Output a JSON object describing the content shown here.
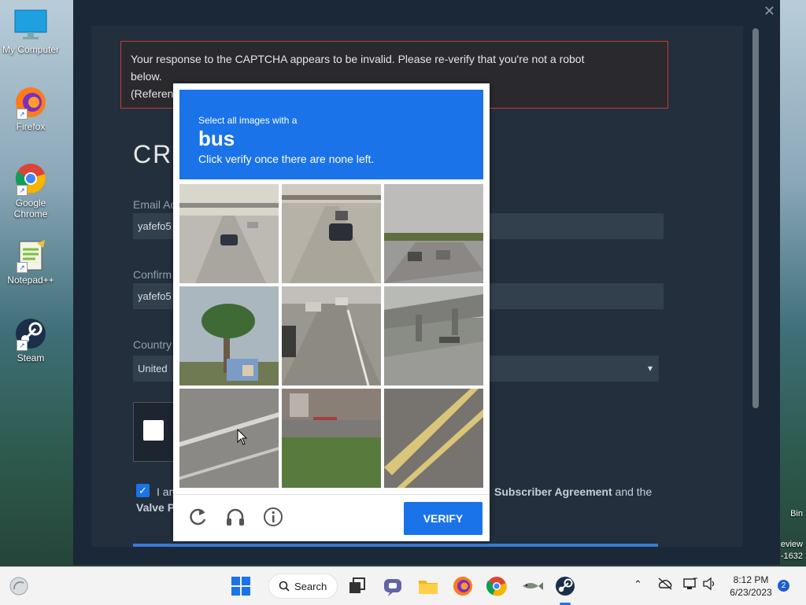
{
  "desktop": {
    "icons": [
      {
        "label": "My Computer"
      },
      {
        "label": "Firefox"
      },
      {
        "label": "Google Chrome"
      },
      {
        "label": "Notepad++"
      },
      {
        "label": "Steam"
      }
    ],
    "right_edge": {
      "bin": "Bin",
      "line1": "eview",
      "line2": "-1632"
    }
  },
  "window": {
    "close_glyph": "✕",
    "error": {
      "line1": "Your response to the CAPTCHA appears to be invalid. Please re-verify that you're not a robot",
      "line2": "below.",
      "line3": "(Referen"
    },
    "title": "CR",
    "email_label": "Email Ac",
    "email_value": "yafefo5",
    "confirm_label": "Confirm",
    "confirm_value": "yafefo5",
    "country_label": "Country",
    "country_value": "United",
    "agree_text": "I am",
    "agree_link1": "Subscriber Agreement",
    "agree_and": "and the",
    "agree_link2": "Valve Pr"
  },
  "captcha": {
    "instruction_line1": "Select all images with a",
    "target": "bus",
    "instruction_line3": "Click verify once there are none left.",
    "verify_label": "VERIFY",
    "icons": [
      "refresh-icon",
      "headphones-icon",
      "info-icon"
    ]
  },
  "taskbar": {
    "search_label": "Search",
    "time": "8:12 PM",
    "date": "6/23/2023",
    "notifications": "2"
  }
}
